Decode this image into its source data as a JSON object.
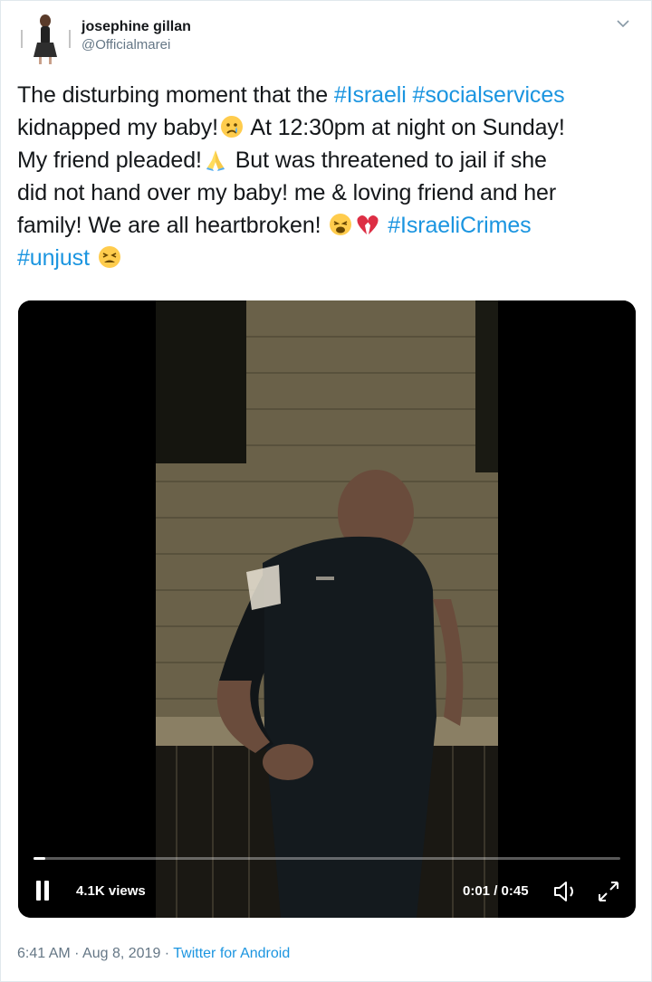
{
  "user": {
    "display_name": "josephine gillan",
    "handle": "@Officialmarei",
    "avatar_icon": "profile-photo"
  },
  "tweet": {
    "line1_a": "The disturbing moment that the ",
    "hashtag_israeli": "#Israeli",
    "space1": " ",
    "hashtag_socialservices": "#socialservices",
    "line2_a": "kidnapped my baby!",
    "line2_b": " At 12:30pm at night on Sunday!",
    "line3_a": "My friend pleaded!",
    "line3_b": " But was threatened to jail if she",
    "line4": "did not hand over my baby! me & loving friend and her",
    "line5_a": "family! We are all heartbroken! ",
    "hashtag_israelicrimes": "#IsraeliCrimes",
    "hashtag_unjust": "#unjust",
    "emoji_names": [
      "crying-face-emoji",
      "folded-hands-emoji",
      "weary-face-emoji",
      "broken-heart-emoji",
      "tired-face-emoji"
    ]
  },
  "video": {
    "views": "4.1K views",
    "time": "0:01 / 0:45",
    "progress_fraction": 0.02,
    "controls_icons": [
      "pause-icon",
      "volume-icon",
      "expand-icon"
    ]
  },
  "meta": {
    "timestamp": "6:41 AM · Aug 8, 2019 · ",
    "source": "Twitter for Android"
  },
  "colors": {
    "link": "#1b95e0",
    "secondary": "#657786",
    "text": "#14171a"
  }
}
